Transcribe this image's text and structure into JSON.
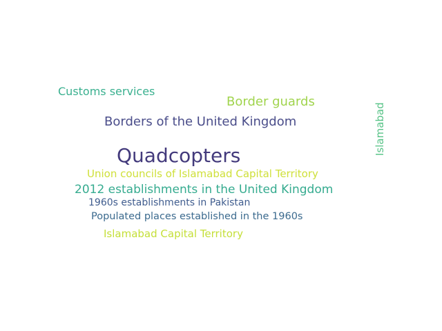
{
  "word_cloud": {
    "words": [
      {
        "text": "Customs services",
        "color": "#3ab08f"
      },
      {
        "text": "Border guards",
        "color": "#a0d44d"
      },
      {
        "text": "Islamabad",
        "color": "#58c387"
      },
      {
        "text": "Borders of the United Kingdom",
        "color": "#4a4d8a"
      },
      {
        "text": "Quadcopters",
        "color": "#433a7c"
      },
      {
        "text": "Union councils of Islamabad Capital Territory",
        "color": "#cfe03a"
      },
      {
        "text": "2012 establishments in the United Kingdom",
        "color": "#35ab8f"
      },
      {
        "text": "1960s establishments in Pakistan",
        "color": "#3f5c8e"
      },
      {
        "text": "Populated places established in the 1960s",
        "color": "#3b6a8e"
      },
      {
        "text": "Islamabad Capital Territory",
        "color": "#c4df37"
      }
    ]
  }
}
